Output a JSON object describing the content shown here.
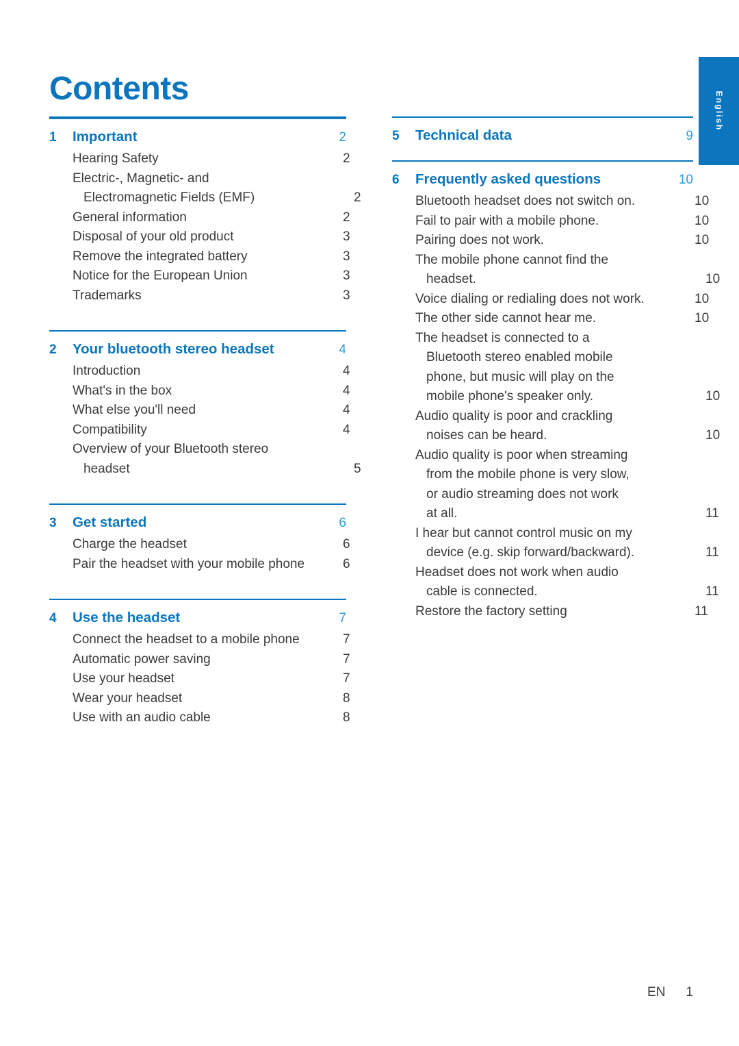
{
  "page": {
    "title": "Contents",
    "language_tab": "English",
    "footer": {
      "locale": "EN",
      "page_number": "1"
    },
    "accent_color": "#0b76bd",
    "page_number_color": "#2e9ad6",
    "text_color": "#3b3b3d"
  },
  "columns": {
    "left": [
      {
        "number": "1",
        "title": "Important",
        "page": "2",
        "rule": "thick",
        "entries": [
          {
            "label": "Hearing Safety",
            "page": "2",
            "continuation": false
          },
          {
            "label": "Electric-, Magnetic- and",
            "page": "",
            "continuation": false
          },
          {
            "label": "Electromagnetic Fields (EMF)",
            "page": "2",
            "continuation": true
          },
          {
            "label": "General information",
            "page": "2",
            "continuation": false
          },
          {
            "label": "Disposal of your old product",
            "page": "3",
            "continuation": false
          },
          {
            "label": "Remove the integrated battery",
            "page": "3",
            "continuation": false
          },
          {
            "label": "Notice for the European Union",
            "page": "3",
            "continuation": false
          },
          {
            "label": "Trademarks",
            "page": "3",
            "continuation": false
          }
        ]
      },
      {
        "number": "2",
        "title": "Your bluetooth stereo headset",
        "page": "4",
        "rule": "thin",
        "entries": [
          {
            "label": "Introduction",
            "page": "4",
            "continuation": false
          },
          {
            "label": "What's in the box",
            "page": "4",
            "continuation": false
          },
          {
            "label": "What else you'll need",
            "page": "4",
            "continuation": false
          },
          {
            "label": "Compatibility",
            "page": "4",
            "continuation": false
          },
          {
            "label": "Overview of your Bluetooth stereo",
            "page": "",
            "continuation": false
          },
          {
            "label": "headset",
            "page": "5",
            "continuation": true
          }
        ]
      },
      {
        "number": "3",
        "title": "Get started",
        "page": "6",
        "rule": "thin",
        "entries": [
          {
            "label": "Charge the headset",
            "page": "6",
            "continuation": false
          },
          {
            "label": "Pair the headset with your mobile phone",
            "page": "6",
            "continuation": false
          }
        ]
      },
      {
        "number": "4",
        "title": "Use the headset",
        "page": "7",
        "rule": "thin",
        "entries": [
          {
            "label": "Connect the headset to a mobile phone",
            "page": "7",
            "continuation": false
          },
          {
            "label": "Automatic power saving",
            "page": "7",
            "continuation": false
          },
          {
            "label": "Use your headset",
            "page": "7",
            "continuation": false
          },
          {
            "label": "Wear your headset",
            "page": "8",
            "continuation": false
          },
          {
            "label": "Use with an audio cable",
            "page": "8",
            "continuation": false
          }
        ]
      }
    ],
    "right": [
      {
        "number": "5",
        "title": "Technical data",
        "page": "9",
        "rule": "thin",
        "entries": []
      },
      {
        "number": "6",
        "title": "Frequently asked questions",
        "page": "10",
        "rule": "thin",
        "entries": [
          {
            "label": "Bluetooth headset does not switch on.",
            "page": "10",
            "continuation": false
          },
          {
            "label": "Fail to pair with a mobile phone.",
            "page": "10",
            "continuation": false
          },
          {
            "label": "Pairing does not work.",
            "page": "10",
            "continuation": false
          },
          {
            "label": "The mobile phone cannot find the",
            "page": "",
            "continuation": false
          },
          {
            "label": "headset.",
            "page": "10",
            "continuation": true
          },
          {
            "label": "Voice dialing or redialing does not work.",
            "page": "10",
            "continuation": false
          },
          {
            "label": "The other side cannot hear me.",
            "page": "10",
            "continuation": false
          },
          {
            "label": "The headset is connected to a",
            "page": "",
            "continuation": false
          },
          {
            "label": "Bluetooth stereo enabled mobile",
            "page": "",
            "continuation": true
          },
          {
            "label": "phone, but music will play on the",
            "page": "",
            "continuation": true
          },
          {
            "label": "mobile phone's speaker only.",
            "page": "10",
            "continuation": true
          },
          {
            "label": "Audio quality is poor and crackling",
            "page": "",
            "continuation": false
          },
          {
            "label": "noises can be heard.",
            "page": "10",
            "continuation": true
          },
          {
            "label": "Audio quality is poor when streaming",
            "page": "",
            "continuation": false
          },
          {
            "label": "from the mobile phone is very slow,",
            "page": "",
            "continuation": true
          },
          {
            "label": "or audio streaming does not work",
            "page": "",
            "continuation": true
          },
          {
            "label": "at all.",
            "page": "11",
            "continuation": true
          },
          {
            "label": "I hear but cannot control music on my",
            "page": "",
            "continuation": false
          },
          {
            "label": "device (e.g. skip forward/backward).",
            "page": "11",
            "continuation": true
          },
          {
            "label": "Headset does not work when audio",
            "page": "",
            "continuation": false
          },
          {
            "label": "cable is connected.",
            "page": "11",
            "continuation": true
          },
          {
            "label": "Restore the factory setting",
            "page": "11",
            "continuation": false
          }
        ]
      }
    ]
  }
}
